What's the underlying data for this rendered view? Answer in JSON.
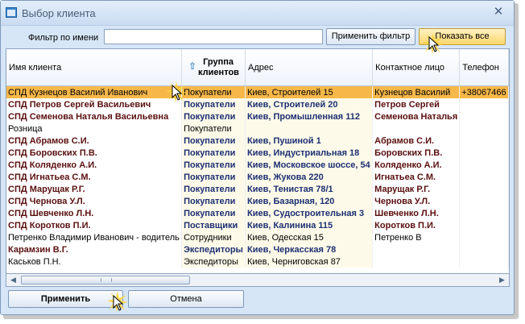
{
  "window": {
    "title": "Выбор клиента",
    "close_glyph": "✕"
  },
  "filter": {
    "label": "Фильтр по имени",
    "value": "",
    "apply_label": "Применить фильтр",
    "show_all_label": "Показать все"
  },
  "columns": [
    {
      "label": "Имя клиента"
    },
    {
      "label": "Группа клиентов"
    },
    {
      "label": "Адрес"
    },
    {
      "label": "Контактное лицо"
    },
    {
      "label": "Телефон"
    }
  ],
  "rows": [
    {
      "name": "СПД Кузнецов Василий Иванович",
      "group": "Покупатели",
      "address": "Киев, Строителей 15",
      "contact": "Кузнецов Василий",
      "phone": "+38067466",
      "style": "selected"
    },
    {
      "name": "СПД Петров Сергей Васильевич",
      "group": "Покупатели",
      "address": "Киев, Строителей 20",
      "contact": "Петров Сергей",
      "phone": "",
      "style": "bold"
    },
    {
      "name": "СПД Семенова Наталья Васильевна",
      "group": "Покупатели",
      "address": "Киев, Промышленная 112",
      "contact": "Семенова Наталья",
      "phone": "",
      "style": "bold"
    },
    {
      "name": "Розница",
      "group": "Покупатели",
      "address": "",
      "contact": "",
      "phone": "",
      "style": "normal"
    },
    {
      "name": "СПД Абрамов С.И.",
      "group": "Покупатели",
      "address": "Киев, Пушиной 1",
      "contact": "Абрамов С.И.",
      "phone": "",
      "style": "bold"
    },
    {
      "name": "СПД Боровских П.В.",
      "group": "Покупатели",
      "address": "Киев, Индустриальная 18",
      "contact": "Боровских П.В.",
      "phone": "",
      "style": "bold"
    },
    {
      "name": "СПД Коляденко А.И.",
      "group": "Покупатели",
      "address": "Киев, Московское шоссе, 54",
      "contact": "Коляденко А.И.",
      "phone": "",
      "style": "bold"
    },
    {
      "name": "СПД Игнатьеа С.М.",
      "group": "Покупатели",
      "address": "Киев, Жукова 220",
      "contact": "Игнатьеа С.М.",
      "phone": "",
      "style": "bold"
    },
    {
      "name": "СПД Марущак Р.Г.",
      "group": "Покупатели",
      "address": "Киев, Тенистая 78/1",
      "contact": "Марущак Р.Г.",
      "phone": "",
      "style": "bold"
    },
    {
      "name": "СПД Чернова У.Л.",
      "group": "Покупатели",
      "address": "Киев, Базарная, 120",
      "contact": "Чернова У.Л.",
      "phone": "",
      "style": "bold"
    },
    {
      "name": "СПД Шевченко Л.Н.",
      "group": "Покупатели",
      "address": "Киев, Судостроительная 3",
      "contact": "Шевченко Л.Н.",
      "phone": "",
      "style": "bold"
    },
    {
      "name": "СПД Коротков П.И.",
      "group": "Поставщики",
      "address": "Киев, Калинина 115",
      "contact": "Коротков П.И.",
      "phone": "",
      "style": "bold"
    },
    {
      "name": "Петренко Владимир Иванович - водитель",
      "group": "Сотрудники",
      "address": "Киев, Одесская 15",
      "contact": "Петренко В",
      "phone": "",
      "style": "normal"
    },
    {
      "name": "Карамзин В.Г.",
      "group": "Экспедиторы",
      "address": "Киев, Черкасская 78",
      "contact": "",
      "phone": "",
      "style": "bold"
    },
    {
      "name": "Каськов П.Н.",
      "group": "Экспедиторы",
      "address": "Киев, Черниговская 87",
      "contact": "",
      "phone": "",
      "style": "normal"
    }
  ],
  "footer": {
    "apply_label": "Применить",
    "cancel_label": "Отмена"
  },
  "colors": {
    "selected_row": "#f7b84a",
    "accent_button": "#fbd56b",
    "bold_text": "#5a0f0f",
    "bold_text_alt": "#1c2f72"
  }
}
